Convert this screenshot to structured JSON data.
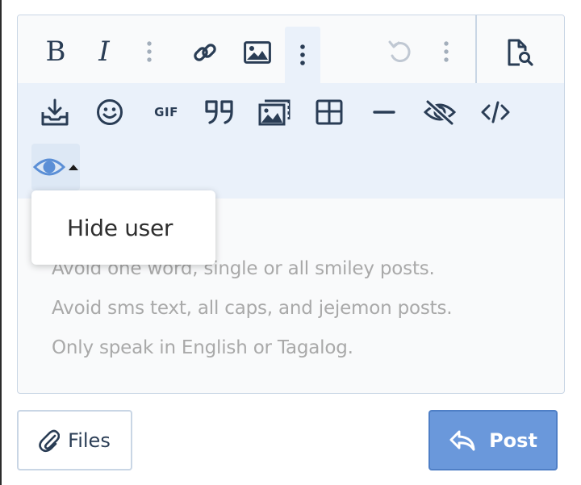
{
  "toolbar": {
    "bold": "B",
    "italic": "I",
    "gif": "GIF"
  },
  "hide_menu": {
    "items": [
      {
        "label": "Hide user"
      }
    ]
  },
  "editor": {
    "placeholder_lines": [
      "Avoid one word, single or all smiley posts.",
      "Avoid sms text, all caps, and jejemon posts.",
      "Only speak in English or Tagalog."
    ]
  },
  "buttons": {
    "files": "Files",
    "post": "Post"
  },
  "colors": {
    "toolbar_icon": "#2a3d55",
    "toolbar_row_bg": "#eaf1fa",
    "active_icon": "#5b8fd6",
    "disabled_icon": "#c0c8d3",
    "post_button_bg": "#6a98db",
    "placeholder_text": "#a9a9a9"
  },
  "icons": [
    "bold-icon",
    "italic-icon",
    "more-vertical-icon",
    "link-icon",
    "image-icon",
    "undo-icon",
    "preview-icon",
    "download-icon",
    "smile-icon",
    "gif-icon",
    "quote-icon",
    "media-icon",
    "table-icon",
    "horizontal-rule-icon",
    "eye-slash-icon",
    "code-icon",
    "eye-icon",
    "caret-up-icon",
    "paperclip-icon",
    "reply-icon"
  ]
}
